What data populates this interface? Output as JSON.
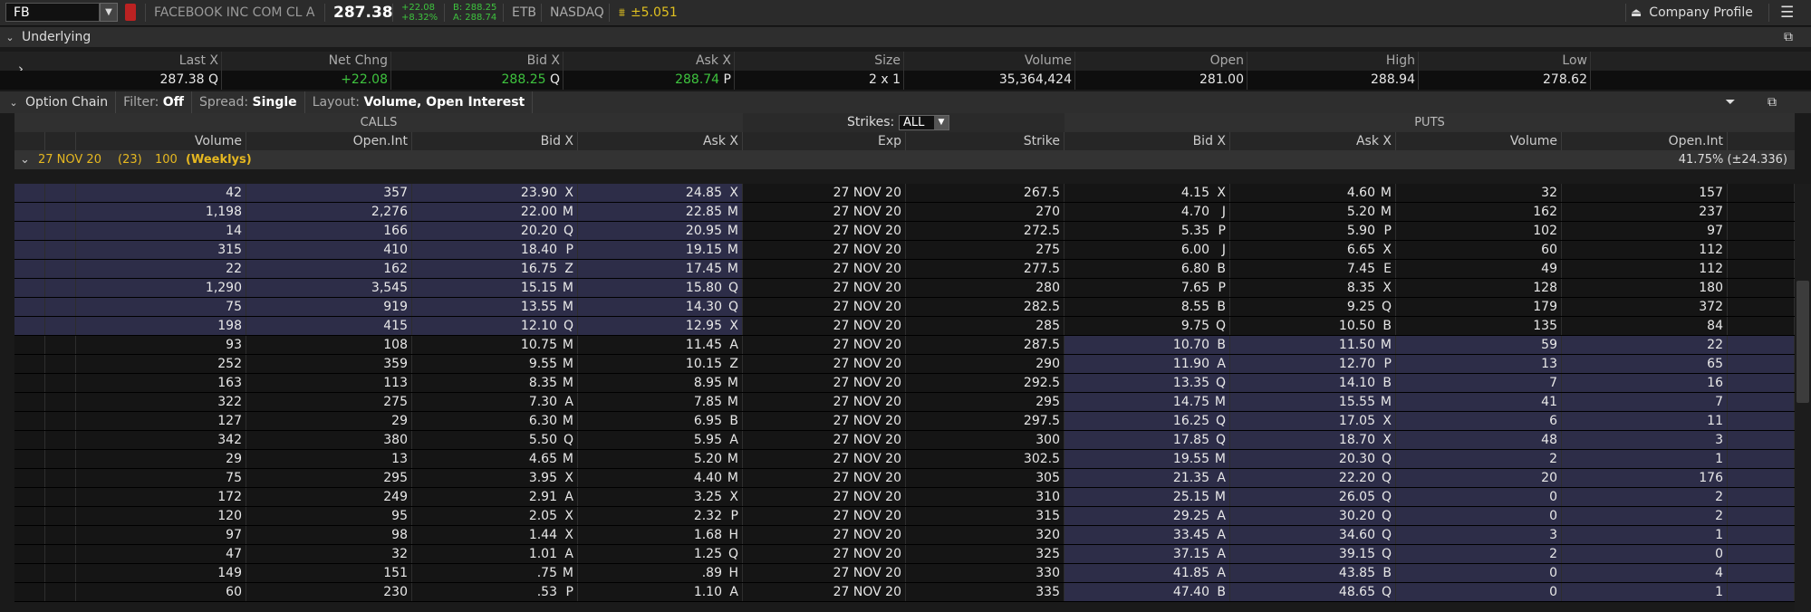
{
  "header": {
    "symbol": "FB",
    "company": "FACEBOOK INC COM CL A",
    "last": "287.38",
    "change_abs": "+22.08",
    "change_pct": "+8.32%",
    "bid": "B: 288.25",
    "ask": "A: 288.74",
    "etb": "ETB",
    "exchange": "NASDAQ",
    "move": "±5.051",
    "company_profile": "Company Profile"
  },
  "underlying": {
    "title": "Underlying",
    "columns": [
      "Last X",
      "Net Chng",
      "Bid X",
      "Ask X",
      "Size",
      "Volume",
      "Open",
      "High",
      "Low"
    ],
    "values": {
      "last": "287.38",
      "last_x": "Q",
      "net": "+22.08",
      "bid": "288.25",
      "bid_x": "Q",
      "ask": "288.74",
      "ask_x": "P",
      "size": "2 x 1",
      "volume": "35,364,424",
      "open": "281.00",
      "high": "288.94",
      "low": "278.62"
    }
  },
  "toolbar": {
    "title": "Option Chain",
    "filter_label": "Filter:",
    "filter_value": "Off",
    "spread_label": "Spread:",
    "spread_value": "Single",
    "layout_label": "Layout:",
    "layout_value": "Volume, Open Interest"
  },
  "groups": {
    "calls": "CALLS",
    "puts": "PUTS",
    "strikes_label": "Strikes:",
    "strikes_value": "ALL"
  },
  "columns": {
    "call": [
      "Volume",
      "Open.Int",
      "Bid X",
      "Ask X"
    ],
    "mid": [
      "Exp",
      "Strike"
    ],
    "put": [
      "Bid X",
      "Ask X",
      "Volume",
      "Open.Int"
    ]
  },
  "expiration": {
    "date": "27 NOV 20",
    "days": "(23)",
    "mult": "100",
    "tag": "(Weeklys)",
    "iv": "41.75% (±24.336)"
  },
  "rows": [
    {
      "cv": "42",
      "coi": "357",
      "cb": "23.90",
      "cbx": "X",
      "ca": "24.85",
      "cax": "X",
      "exp": "27 NOV 20",
      "strike": "267.5",
      "pb": "4.15",
      "pbx": "X",
      "pa": "4.60",
      "pax": "M",
      "pv": "32",
      "poi": "157"
    },
    {
      "cv": "1,198",
      "coi": "2,276",
      "cb": "22.00",
      "cbx": "M",
      "ca": "22.85",
      "cax": "M",
      "exp": "27 NOV 20",
      "strike": "270",
      "pb": "4.70",
      "pbx": "J",
      "pa": "5.20",
      "pax": "M",
      "pv": "162",
      "poi": "237"
    },
    {
      "cv": "14",
      "coi": "166",
      "cb": "20.20",
      "cbx": "Q",
      "ca": "20.95",
      "cax": "M",
      "exp": "27 NOV 20",
      "strike": "272.5",
      "pb": "5.35",
      "pbx": "P",
      "pa": "5.90",
      "pax": "P",
      "pv": "102",
      "poi": "97"
    },
    {
      "cv": "315",
      "coi": "410",
      "cb": "18.40",
      "cbx": "P",
      "ca": "19.15",
      "cax": "M",
      "exp": "27 NOV 20",
      "strike": "275",
      "pb": "6.00",
      "pbx": "J",
      "pa": "6.65",
      "pax": "X",
      "pv": "60",
      "poi": "112"
    },
    {
      "cv": "22",
      "coi": "162",
      "cb": "16.75",
      "cbx": "Z",
      "ca": "17.45",
      "cax": "M",
      "exp": "27 NOV 20",
      "strike": "277.5",
      "pb": "6.80",
      "pbx": "B",
      "pa": "7.45",
      "pax": "E",
      "pv": "49",
      "poi": "112"
    },
    {
      "cv": "1,290",
      "coi": "3,545",
      "cb": "15.15",
      "cbx": "M",
      "ca": "15.80",
      "cax": "Q",
      "exp": "27 NOV 20",
      "strike": "280",
      "pb": "7.65",
      "pbx": "P",
      "pa": "8.35",
      "pax": "X",
      "pv": "128",
      "poi": "180"
    },
    {
      "cv": "75",
      "coi": "919",
      "cb": "13.55",
      "cbx": "M",
      "ca": "14.30",
      "cax": "Q",
      "exp": "27 NOV 20",
      "strike": "282.5",
      "pb": "8.55",
      "pbx": "B",
      "pa": "9.25",
      "pax": "Q",
      "pv": "179",
      "poi": "372"
    },
    {
      "cv": "198",
      "coi": "415",
      "cb": "12.10",
      "cbx": "Q",
      "ca": "12.95",
      "cax": "X",
      "exp": "27 NOV 20",
      "strike": "285",
      "pb": "9.75",
      "pbx": "Q",
      "pa": "10.50",
      "pax": "B",
      "pv": "135",
      "poi": "84"
    },
    {
      "cv": "93",
      "coi": "108",
      "cb": "10.75",
      "cbx": "M",
      "ca": "11.45",
      "cax": "A",
      "exp": "27 NOV 20",
      "strike": "287.5",
      "pb": "10.70",
      "pbx": "B",
      "pa": "11.50",
      "pax": "M",
      "pv": "59",
      "poi": "22"
    },
    {
      "cv": "252",
      "coi": "359",
      "cb": "9.55",
      "cbx": "M",
      "ca": "10.15",
      "cax": "Z",
      "exp": "27 NOV 20",
      "strike": "290",
      "pb": "11.90",
      "pbx": "A",
      "pa": "12.70",
      "pax": "P",
      "pv": "13",
      "poi": "65"
    },
    {
      "cv": "163",
      "coi": "113",
      "cb": "8.35",
      "cbx": "M",
      "ca": "8.95",
      "cax": "M",
      "exp": "27 NOV 20",
      "strike": "292.5",
      "pb": "13.35",
      "pbx": "Q",
      "pa": "14.10",
      "pax": "B",
      "pv": "7",
      "poi": "16"
    },
    {
      "cv": "322",
      "coi": "275",
      "cb": "7.30",
      "cbx": "A",
      "ca": "7.85",
      "cax": "M",
      "exp": "27 NOV 20",
      "strike": "295",
      "pb": "14.75",
      "pbx": "M",
      "pa": "15.55",
      "pax": "M",
      "pv": "41",
      "poi": "7"
    },
    {
      "cv": "127",
      "coi": "29",
      "cb": "6.30",
      "cbx": "M",
      "ca": "6.95",
      "cax": "B",
      "exp": "27 NOV 20",
      "strike": "297.5",
      "pb": "16.25",
      "pbx": "Q",
      "pa": "17.05",
      "pax": "X",
      "pv": "6",
      "poi": "11"
    },
    {
      "cv": "342",
      "coi": "380",
      "cb": "5.50",
      "cbx": "Q",
      "ca": "5.95",
      "cax": "A",
      "exp": "27 NOV 20",
      "strike": "300",
      "pb": "17.85",
      "pbx": "Q",
      "pa": "18.70",
      "pax": "X",
      "pv": "48",
      "poi": "3"
    },
    {
      "cv": "29",
      "coi": "13",
      "cb": "4.65",
      "cbx": "M",
      "ca": "5.20",
      "cax": "M",
      "exp": "27 NOV 20",
      "strike": "302.5",
      "pb": "19.55",
      "pbx": "M",
      "pa": "20.30",
      "pax": "Q",
      "pv": "2",
      "poi": "1"
    },
    {
      "cv": "75",
      "coi": "295",
      "cb": "3.95",
      "cbx": "X",
      "ca": "4.40",
      "cax": "M",
      "exp": "27 NOV 20",
      "strike": "305",
      "pb": "21.35",
      "pbx": "A",
      "pa": "22.20",
      "pax": "Q",
      "pv": "20",
      "poi": "176"
    },
    {
      "cv": "172",
      "coi": "249",
      "cb": "2.91",
      "cbx": "A",
      "ca": "3.25",
      "cax": "X",
      "exp": "27 NOV 20",
      "strike": "310",
      "pb": "25.15",
      "pbx": "M",
      "pa": "26.05",
      "pax": "Q",
      "pv": "0",
      "poi": "2"
    },
    {
      "cv": "120",
      "coi": "95",
      "cb": "2.05",
      "cbx": "X",
      "ca": "2.32",
      "cax": "P",
      "exp": "27 NOV 20",
      "strike": "315",
      "pb": "29.25",
      "pbx": "A",
      "pa": "30.20",
      "pax": "Q",
      "pv": "0",
      "poi": "2"
    },
    {
      "cv": "97",
      "coi": "98",
      "cb": "1.44",
      "cbx": "X",
      "ca": "1.68",
      "cax": "H",
      "exp": "27 NOV 20",
      "strike": "320",
      "pb": "33.45",
      "pbx": "A",
      "pa": "34.60",
      "pax": "Q",
      "pv": "3",
      "poi": "1"
    },
    {
      "cv": "47",
      "coi": "32",
      "cb": "1.01",
      "cbx": "A",
      "ca": "1.25",
      "cax": "Q",
      "exp": "27 NOV 20",
      "strike": "325",
      "pb": "37.15",
      "pbx": "A",
      "pa": "39.15",
      "pax": "Q",
      "pv": "2",
      "poi": "0"
    },
    {
      "cv": "149",
      "coi": "151",
      "cb": ".75",
      "cbx": "M",
      "ca": ".89",
      "cax": "H",
      "exp": "27 NOV 20",
      "strike": "330",
      "pb": "41.85",
      "pbx": "A",
      "pa": "43.85",
      "pax": "B",
      "pv": "0",
      "poi": "4"
    },
    {
      "cv": "60",
      "coi": "230",
      "cb": ".53",
      "cbx": "P",
      "ca": "1.10",
      "cax": "A",
      "exp": "27 NOV 20",
      "strike": "335",
      "pb": "47.40",
      "pbx": "B",
      "pa": "48.65",
      "pax": "Q",
      "pv": "0",
      "poi": "1"
    }
  ]
}
